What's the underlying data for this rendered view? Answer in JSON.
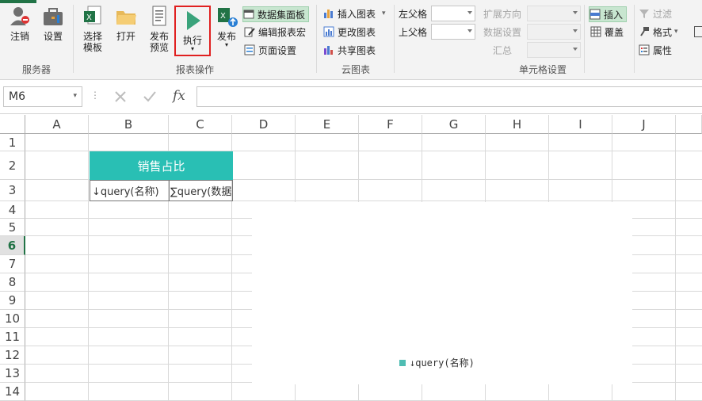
{
  "ribbon": {
    "server_group": {
      "label": "服务器",
      "logout": "注销",
      "settings": "设置"
    },
    "report_ops": {
      "label": "报表操作",
      "select_template": [
        "选择",
        "模板"
      ],
      "open": "打开",
      "publish_preview": [
        "发布",
        "预览"
      ],
      "execute": "执行",
      "publish": "发布",
      "dataset_panel": "数据集面板",
      "edit_macro": "编辑报表宏",
      "page_setup": "页面设置"
    },
    "cloud_chart": {
      "label": "云图表",
      "insert": "插入图表",
      "modify": "更改图表",
      "share": "共享图表"
    },
    "cell_settings": {
      "label": "单元格设置",
      "left_parent": "左父格",
      "top_parent": "上父格",
      "expand_dir": "扩展方向",
      "data_setting": "数据设置",
      "summary": "汇总",
      "insert": "插入",
      "overwrite": "覆盖",
      "filter": "过滤",
      "format": "格式",
      "properties": "属性"
    }
  },
  "formula_bar": {
    "name_box": "M6",
    "formula": "",
    "fx": "fx"
  },
  "columns": [
    "A",
    "B",
    "C",
    "D",
    "E",
    "F",
    "G",
    "H",
    "I",
    "J"
  ],
  "rows": [
    "1",
    "2",
    "3",
    "4",
    "5",
    "6",
    "7",
    "8",
    "9",
    "10",
    "11",
    "12",
    "13",
    "14"
  ],
  "selected_row": "6",
  "cells": {
    "title": "销售占比",
    "b3": "↓query(名称)",
    "c3": "∑query(数据)"
  },
  "chart_data": {
    "type": "pie",
    "title": "",
    "legend": [
      {
        "name": "↓query(名称)",
        "color": "#4fbdb3"
      }
    ],
    "values": []
  },
  "colors": {
    "accent": "#217346",
    "header_fill": "#29bfb4",
    "highlight_border": "#e02020"
  }
}
